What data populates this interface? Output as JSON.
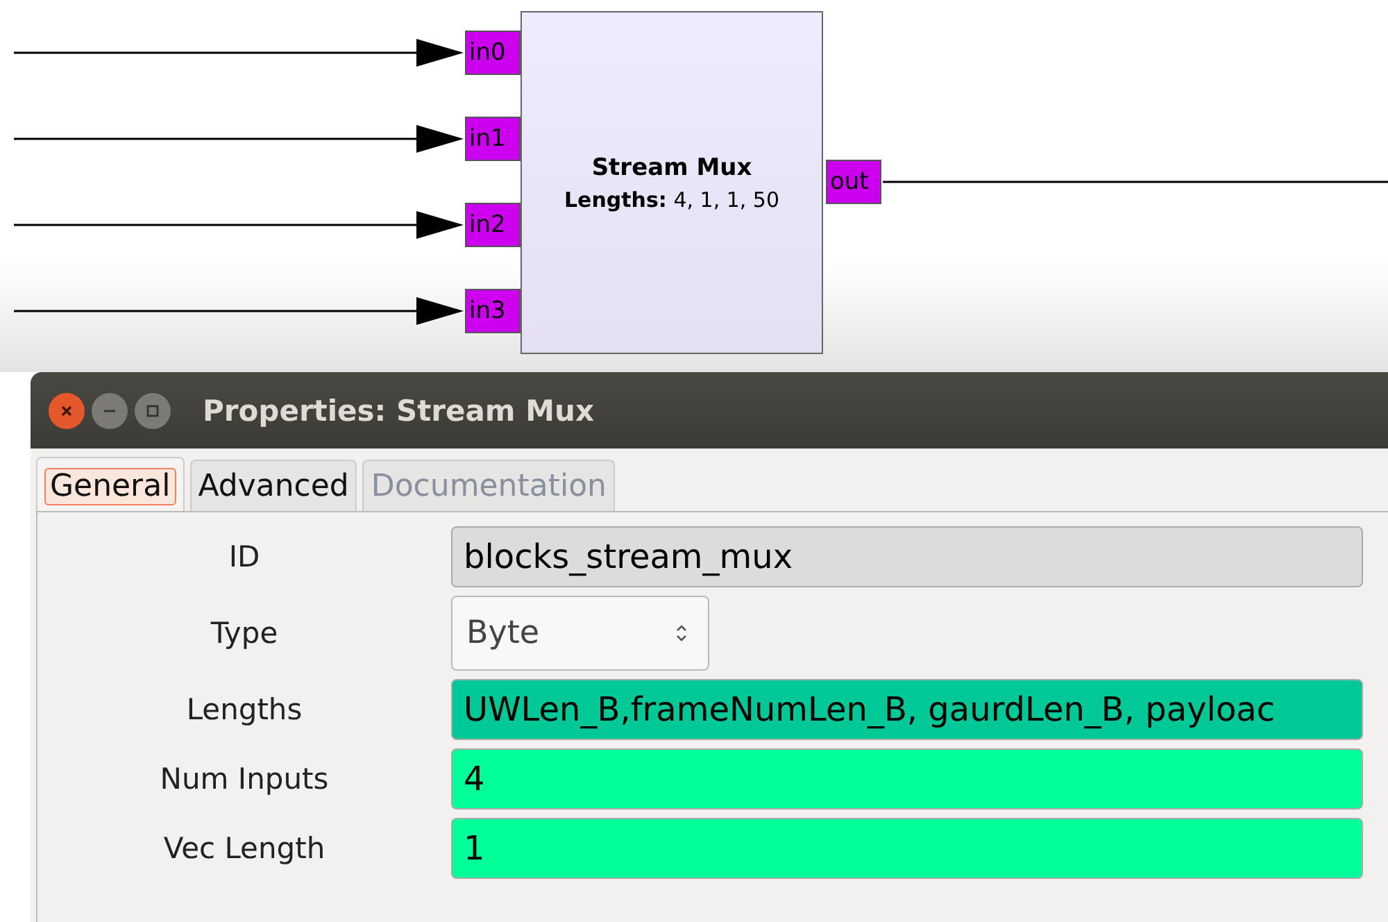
{
  "block": {
    "title": "Stream Mux",
    "param_label": "Lengths:",
    "param_value": "4, 1, 1, 50",
    "inputs": [
      "in0",
      "in1",
      "in2",
      "in3"
    ],
    "outputs": [
      "out"
    ]
  },
  "window": {
    "title": "Properties: Stream Mux"
  },
  "tabs": [
    {
      "label": "General",
      "selected": true,
      "disabled": false
    },
    {
      "label": "Advanced",
      "selected": false,
      "disabled": false
    },
    {
      "label": "Documentation",
      "selected": false,
      "disabled": true
    }
  ],
  "params": [
    {
      "label": "ID",
      "kind": "entry",
      "value": "blocks_stream_mux",
      "color": "#dcdcdc"
    },
    {
      "label": "Type",
      "kind": "combo",
      "value": "Byte"
    },
    {
      "label": "Lengths",
      "kind": "entry",
      "value": "UWLen_B,frameNumLen_B, gaurdLen_B, payloac",
      "color": "#00c896"
    },
    {
      "label": "Num Inputs",
      "kind": "entry",
      "value": "4",
      "color": "#00ff99"
    },
    {
      "label": "Vec Length",
      "kind": "entry",
      "value": "1",
      "color": "#00ff99"
    }
  ]
}
